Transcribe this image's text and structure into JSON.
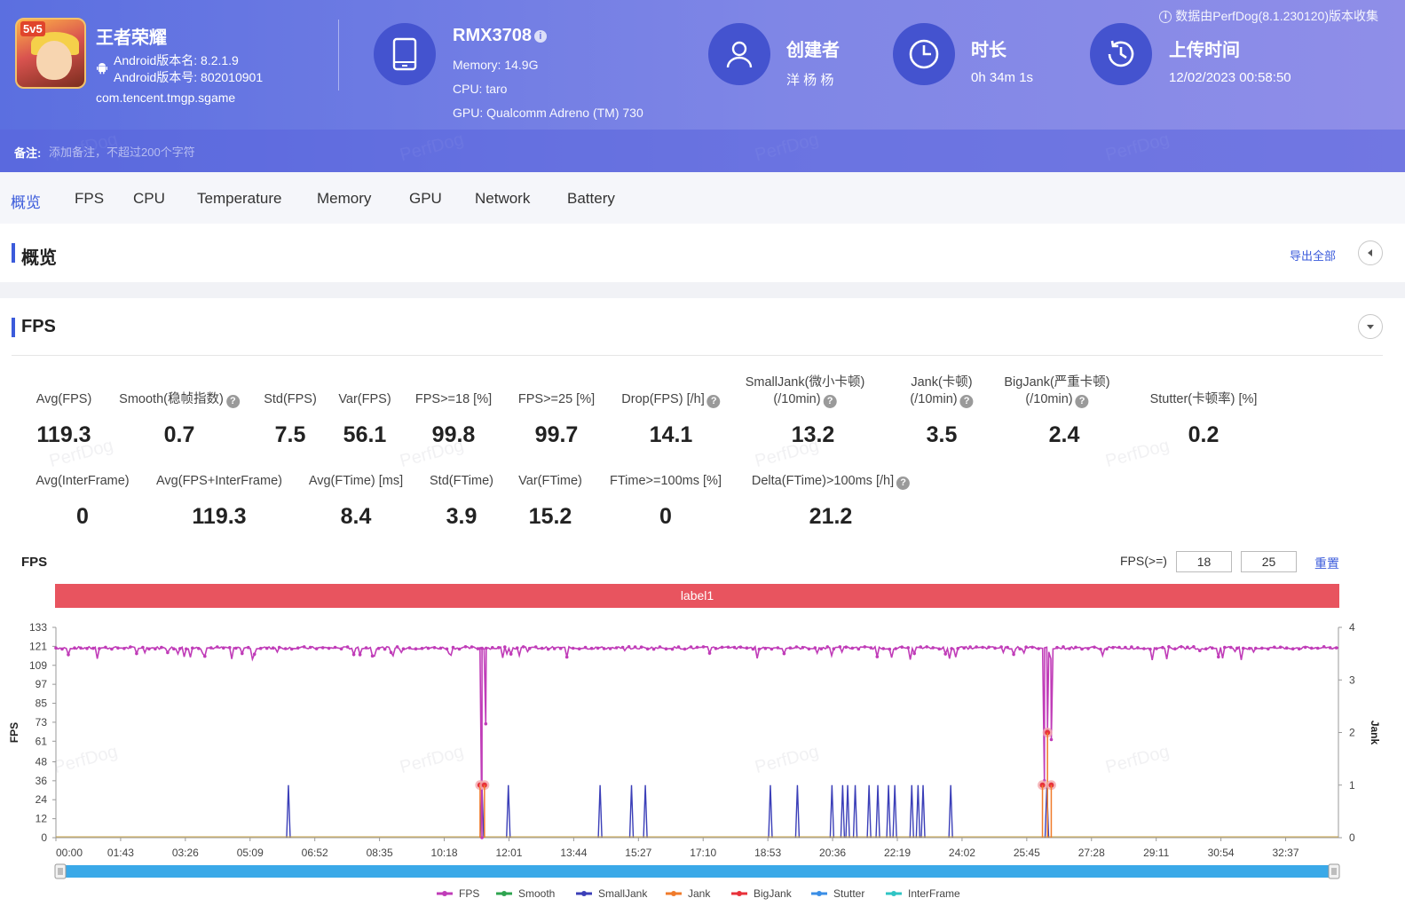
{
  "header": {
    "notice": "数据由PerfDog(8.1.230120)版本收集",
    "app": {
      "badge": "5v5",
      "name": "王者荣耀",
      "version_name": "Android版本名: 8.2.1.9",
      "version_code": "Android版本号: 802010901",
      "package": "com.tencent.tmgp.sgame"
    },
    "device": {
      "model": "RMX3708",
      "memory": "Memory: 14.9G",
      "cpu": "CPU: taro",
      "gpu": "GPU: Qualcomm Adreno (TM) 730"
    },
    "creator": {
      "title": "创建者",
      "value": "洋 杨 杨"
    },
    "duration": {
      "title": "时长",
      "value": "0h 34m 1s"
    },
    "upload": {
      "title": "上传时间",
      "value": "12/02/2023 00:58:50"
    },
    "remark_label": "备注:",
    "remark_placeholder": "添加备注，不超过200个字符",
    "watermark": "PerfDog"
  },
  "tabs": [
    "概览",
    "FPS",
    "CPU",
    "Temperature",
    "Memory",
    "GPU",
    "Network",
    "Battery"
  ],
  "overview": {
    "title": "概览",
    "export": "导出全部"
  },
  "fps_section": {
    "title": "FPS",
    "metrics_row1": [
      {
        "label": "Avg(FPS)",
        "value": "119.3"
      },
      {
        "label": "Smooth(稳帧指数)",
        "value": "0.7",
        "help": true
      },
      {
        "label": "Std(FPS)",
        "value": "7.5"
      },
      {
        "label": "Var(FPS)",
        "value": "56.1"
      },
      {
        "label": "FPS>=18 [%]",
        "value": "99.8"
      },
      {
        "label": "FPS>=25 [%]",
        "value": "99.7"
      },
      {
        "label": "Drop(FPS) [/h]",
        "value": "14.1",
        "help": true
      },
      {
        "label": "SmallJank(微小卡顿)",
        "label2": "(/10min)",
        "value": "13.2",
        "help": true
      },
      {
        "label": "Jank(卡顿)",
        "label2": "(/10min)",
        "value": "3.5",
        "help": true
      },
      {
        "label": "BigJank(严重卡顿)",
        "label2": "(/10min)",
        "value": "2.4",
        "help": true
      },
      {
        "label": "Stutter(卡顿率) [%]",
        "value": "0.2"
      }
    ],
    "metrics_row2": [
      {
        "label": "Avg(InterFrame)",
        "value": "0"
      },
      {
        "label": "Avg(FPS+InterFrame)",
        "value": "119.3"
      },
      {
        "label": "Avg(FTime) [ms]",
        "value": "8.4"
      },
      {
        "label": "Std(FTime)",
        "value": "3.9"
      },
      {
        "label": "Var(FTime)",
        "value": "15.2"
      },
      {
        "label": "FTime>=100ms [%]",
        "value": "0"
      },
      {
        "label": "Delta(FTime)>100ms [/h]",
        "value": "21.2",
        "help": true
      }
    ],
    "chart_title": "FPS",
    "threshold_label": "FPS(>=)",
    "threshold_low": "18",
    "threshold_high": "25",
    "reset": "重置",
    "label_bar": "label1"
  },
  "chart_data": {
    "type": "line",
    "ylabel": "FPS",
    "y2label": "Jank",
    "ylim": [
      0,
      133
    ],
    "y2lim": [
      0,
      4
    ],
    "y_ticks": [
      0,
      12,
      24,
      36,
      48,
      61,
      73,
      85,
      97,
      109,
      121,
      133
    ],
    "y2_ticks": [
      0,
      1,
      2,
      3,
      4
    ],
    "x_ticks": [
      "00:00",
      "01:43",
      "03:26",
      "05:09",
      "06:52",
      "08:35",
      "10:18",
      "12:01",
      "13:44",
      "15:27",
      "17:10",
      "18:53",
      "20:36",
      "22:19",
      "24:02",
      "25:45",
      "27:28",
      "29:11",
      "30:54",
      "32:37"
    ],
    "duration_s": 2041,
    "legend": [
      {
        "name": "FPS",
        "color": "#c03cb8"
      },
      {
        "name": "Smooth",
        "color": "#2ea44f"
      },
      {
        "name": "SmallJank",
        "color": "#3b3fb8"
      },
      {
        "name": "Jank",
        "color": "#f07b2b"
      },
      {
        "name": "BigJank",
        "color": "#e8323a"
      },
      {
        "name": "Stutter",
        "color": "#3a8ee6"
      },
      {
        "name": "InterFrame",
        "color": "#2fc4c4"
      }
    ],
    "series": [
      {
        "name": "FPS",
        "baseline": 120,
        "drops": [
          {
            "t": 678,
            "v": 0
          },
          {
            "t": 684,
            "v": 72
          },
          {
            "t": 1573,
            "v": 36
          },
          {
            "t": 1578,
            "v": 68
          },
          {
            "t": 1584,
            "v": 62
          }
        ]
      },
      {
        "name": "SmallJank",
        "spikes_t": [
          370,
          678,
          720,
          866,
          916,
          938,
          1137,
          1180,
          1235,
          1252,
          1260,
          1272,
          1294,
          1308,
          1325,
          1335,
          1362,
          1372,
          1380,
          1424,
          1577
        ]
      },
      {
        "name": "BigJank",
        "points": [
          {
            "t": 675,
            "v": 1
          },
          {
            "t": 682,
            "v": 1
          },
          {
            "t": 1570,
            "v": 1
          },
          {
            "t": 1578,
            "v": 2
          },
          {
            "t": 1584,
            "v": 1
          }
        ]
      }
    ]
  }
}
